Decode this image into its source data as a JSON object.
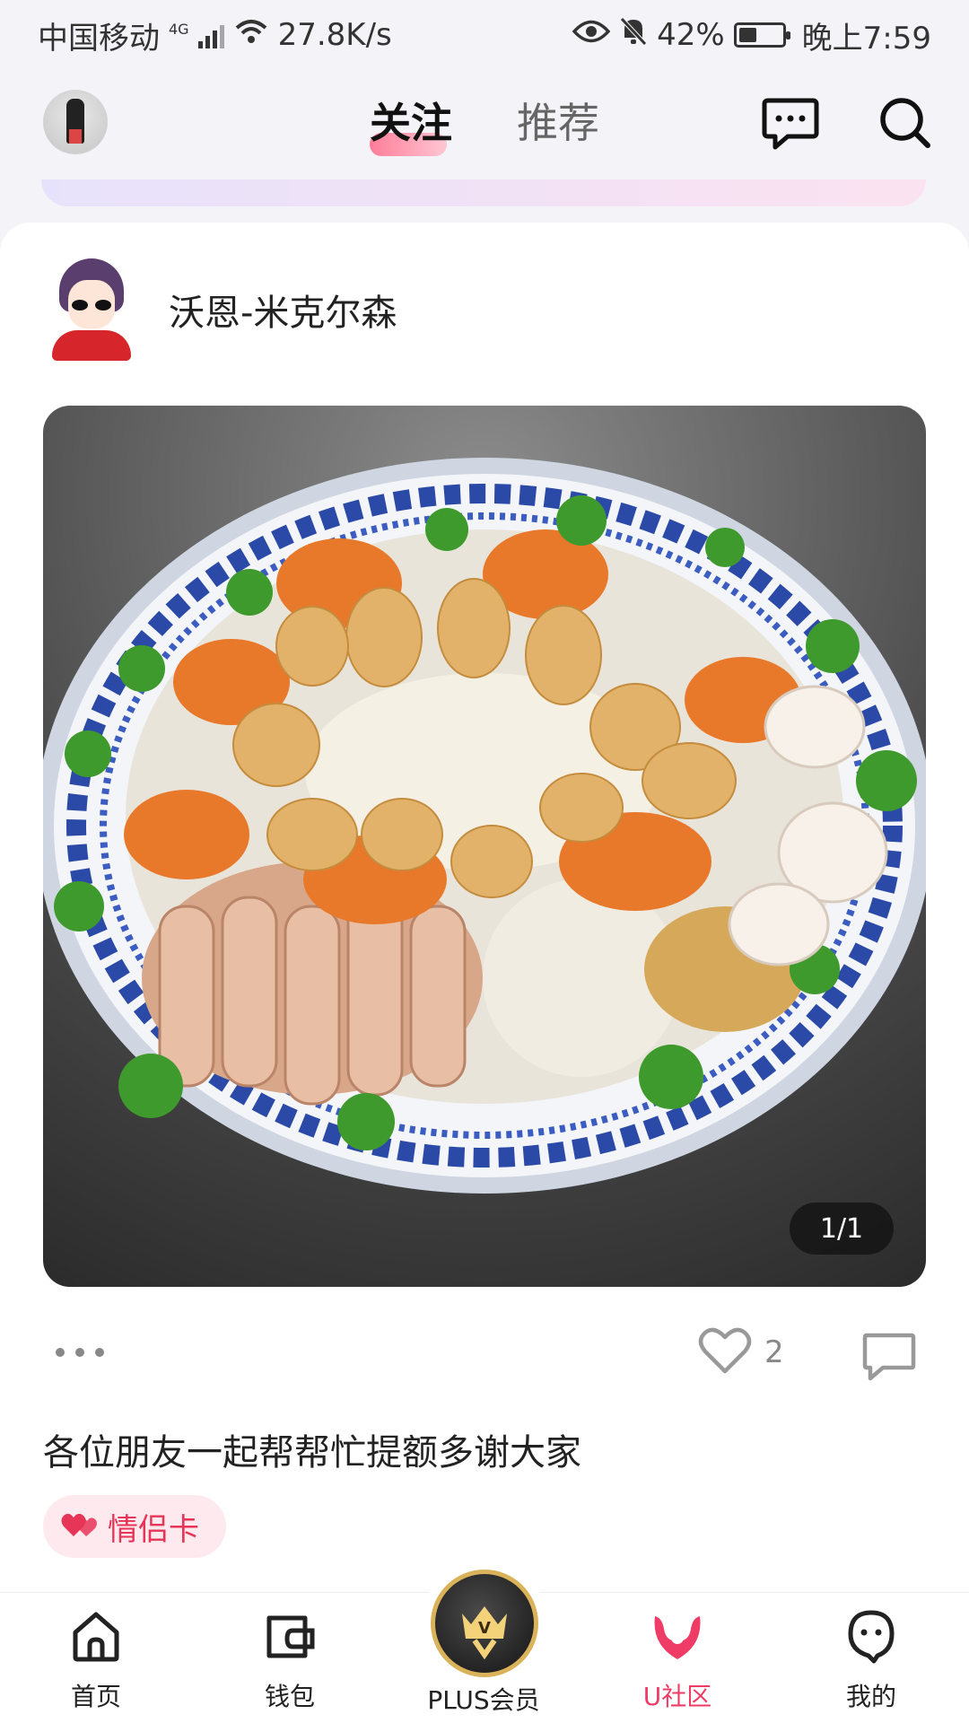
{
  "status_bar": {
    "carrier": "中国移动",
    "network": "4G",
    "speed": "27.8K/s",
    "battery": "42%",
    "battery_level": 0.42,
    "time": "晚上7:59"
  },
  "top_nav": {
    "tabs": [
      {
        "label": "关注",
        "active": true
      },
      {
        "label": "推荐",
        "active": false
      }
    ]
  },
  "post": {
    "author": "沃恩-米克尔森",
    "image_counter": "1/1",
    "likes": "2",
    "title": "各位朋友一起帮帮忙提额多谢大家",
    "tag": "情侣卡"
  },
  "bottom_nav": {
    "items": [
      {
        "label": "首页",
        "icon": "home-icon",
        "active": false
      },
      {
        "label": "钱包",
        "icon": "wallet-icon",
        "active": false
      },
      {
        "label": "PLUS会员",
        "icon": "plus-member-icon",
        "active": false
      },
      {
        "label": "U社区",
        "icon": "community-icon",
        "active": true
      },
      {
        "label": "我的",
        "icon": "profile-icon",
        "active": false
      }
    ]
  },
  "colors": {
    "accent": "#ef3c66",
    "tag_bg": "#fde9ee",
    "plus_gold": "#d9b25a"
  }
}
